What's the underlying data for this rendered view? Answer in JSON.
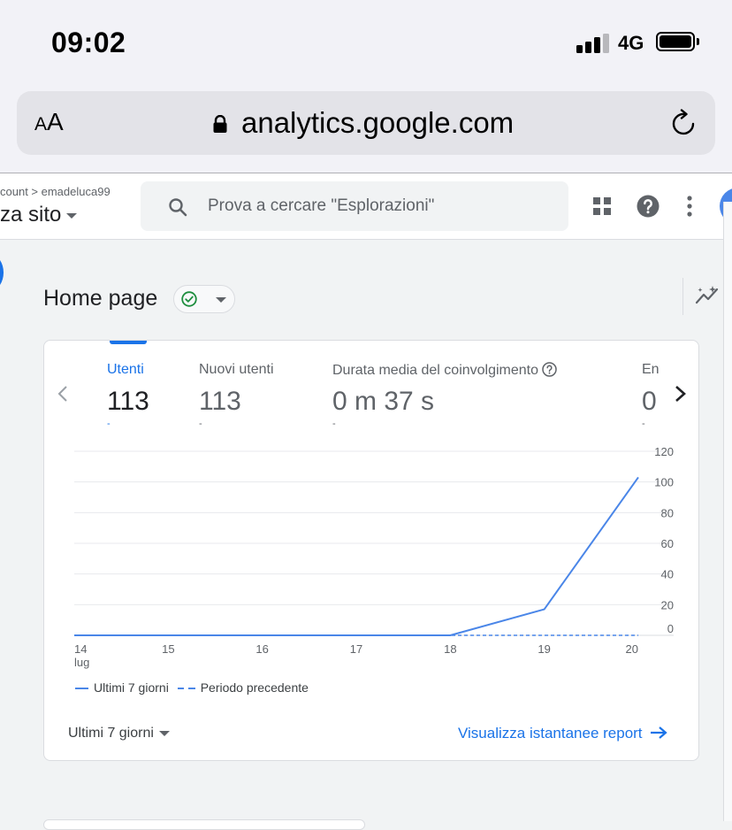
{
  "status_bar": {
    "time": "09:02",
    "network": "4G"
  },
  "browser": {
    "text_size_small": "A",
    "text_size_large": "A",
    "url": "analytics.google.com"
  },
  "header": {
    "breadcrumb": "count > emadeluca99",
    "property": "za sito",
    "search_placeholder": "Prova a cercare \"Esplorazioni\""
  },
  "page": {
    "title": "Home page"
  },
  "metrics": [
    {
      "label": "Utenti",
      "value": "113",
      "change": "-"
    },
    {
      "label": "Nuovi utenti",
      "value": "113",
      "change": "-"
    },
    {
      "label": "Durata media del coinvolgimento",
      "value": "0 m 37 s",
      "change": "-"
    },
    {
      "label": "Ent",
      "value": "0",
      "change": "-"
    }
  ],
  "chart_data": {
    "type": "line",
    "x": [
      "14",
      "15",
      "16",
      "17",
      "18",
      "19",
      "20"
    ],
    "x_sublabel_first": "lug",
    "series": [
      {
        "name": "Ultimi 7 giorni",
        "values": [
          0,
          0,
          0,
          0,
          0,
          17,
          103
        ],
        "style": "solid",
        "color": "#4a86e8"
      },
      {
        "name": "Periodo precedente",
        "values": [
          0,
          0,
          0,
          0,
          0,
          0,
          0
        ],
        "style": "dashed",
        "color": "#4a86e8"
      }
    ],
    "y_ticks": [
      0,
      20,
      40,
      60,
      80,
      100,
      120
    ],
    "ylim": [
      0,
      120
    ],
    "y_axis_side": "right",
    "grid": true,
    "legend_position": "bottom-left"
  },
  "card_footer": {
    "period": "Ultimi 7 giorni",
    "report_link": "Visualizza istantanee report"
  }
}
